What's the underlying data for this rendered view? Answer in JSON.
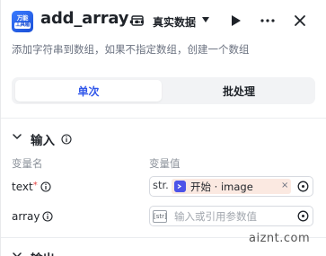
{
  "header": {
    "logo_line1": "万能",
    "logo_line2": "工具箱",
    "title": "add_array…",
    "mode_label": "真实数据"
  },
  "description": "添加字符串到数组，如果不指定数组，创建一个数组",
  "tabs": [
    {
      "label": "单次",
      "active": true
    },
    {
      "label": "批处理",
      "active": false
    }
  ],
  "input_section": {
    "title": "输入",
    "col_var_name": "变量名",
    "col_var_value": "变量值",
    "rows": [
      {
        "name": "text",
        "required_mark": "*",
        "type_tag": "str.",
        "ref_text": "开始 · image",
        "clear": "×"
      },
      {
        "name": "array",
        "type_badge": "[str]",
        "placeholder": "输入或引用参数值"
      }
    ]
  },
  "output_section": {
    "title": "输出"
  },
  "watermark": "aiznt.com",
  "colors": {
    "accent": "#3157ea",
    "chip_bg": "#fbe9e1",
    "ref_icon": "#4d53e8",
    "required": "#e54545"
  }
}
